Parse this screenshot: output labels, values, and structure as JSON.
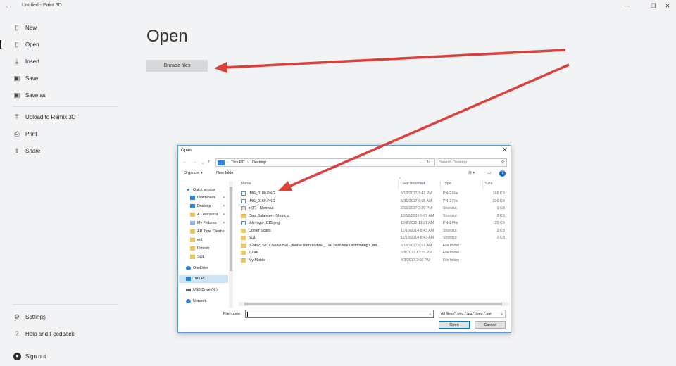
{
  "window": {
    "title": "Untitled - Paint 3D",
    "minimize_glyph": "—",
    "restore_glyph": "❐",
    "close_glyph": "✕"
  },
  "menu": {
    "items": [
      {
        "label": "New",
        "icon": "new-file-icon"
      },
      {
        "label": "Open",
        "icon": "folder-open-icon",
        "active": true
      },
      {
        "label": "Insert",
        "icon": "insert-icon"
      },
      {
        "label": "Save",
        "icon": "save-icon"
      },
      {
        "label": "Save as",
        "icon": "save-as-icon"
      },
      {
        "label": "Upload to Remix 3D",
        "icon": "upload-icon"
      },
      {
        "label": "Print",
        "icon": "print-icon"
      },
      {
        "label": "Share",
        "icon": "share-icon"
      }
    ],
    "bottom": [
      {
        "label": "Settings",
        "icon": "gear-icon"
      },
      {
        "label": "Help and Feedback",
        "icon": "help-icon"
      },
      {
        "label": "Sign out",
        "icon": "user-icon"
      }
    ]
  },
  "main": {
    "heading": "Open",
    "browse_label": "Browse files"
  },
  "dialog": {
    "title": "Open",
    "breadcrumb": [
      "This PC",
      "Desktop"
    ],
    "search_placeholder": "Search Desktop",
    "organize_label": "Organize ▾",
    "new_folder_label": "New folder",
    "nav": [
      {
        "label": "Quick access",
        "icon": "star-icon"
      },
      {
        "label": "Downloads",
        "icon": "download-icon",
        "pinned": true
      },
      {
        "label": "Desktop",
        "icon": "desktop-icon",
        "pinned": true
      },
      {
        "label": "A.Levasseur",
        "icon": "folder-icon",
        "pinned": true
      },
      {
        "label": "My Pictures",
        "icon": "pictures-icon",
        "pinned": true
      },
      {
        "label": "AR Type Clean u",
        "icon": "folder-icon"
      },
      {
        "label": "edi",
        "icon": "folder-icon"
      },
      {
        "label": "Fintech",
        "icon": "folder-icon"
      },
      {
        "label": "SQL",
        "icon": "folder-icon"
      },
      {
        "label": "OneDrive",
        "icon": "cloud-icon"
      },
      {
        "label": "This PC",
        "icon": "computer-icon",
        "selected": true
      },
      {
        "label": "USB Drive (K:)",
        "icon": "usb-drive-icon"
      },
      {
        "label": "Network",
        "icon": "network-icon"
      }
    ],
    "columns": [
      "Name",
      "Date modified",
      "Type",
      "Size"
    ],
    "files": [
      {
        "name": "IMG_0180.PNG",
        "date": "6/13/2017 3:41 PM",
        "type": "PNG File",
        "size": "166 KB",
        "kind": "png"
      },
      {
        "name": "IMG_0169.PNG",
        "date": "5/31/2017 6:55 AM",
        "type": "PNG File",
        "size": "236 KB",
        "kind": "png"
      },
      {
        "name": "z (F) - Shortcut",
        "date": "2/15/2017 2:20 PM",
        "type": "Shortcut",
        "size": "1 KB",
        "kind": "lnk"
      },
      {
        "name": "Data Balancer - Shortcut",
        "date": "12/12/2016 9:07 AM",
        "type": "Shortcut",
        "size": "2 KB",
        "kind": "lnk"
      },
      {
        "name": "ddc-logo-1015.png",
        "date": "12/8/2015 11:21 AM",
        "type": "PNG File",
        "size": "25 KB",
        "kind": "png"
      },
      {
        "name": "Copier Scans",
        "date": "11/18/2014 8:43 AM",
        "type": "Shortcut",
        "size": "2 KB",
        "kind": "folder"
      },
      {
        "name": "SQL",
        "date": "11/18/2014 8:43 AM",
        "type": "Shortcut",
        "size": "2 KB",
        "kind": "folder"
      },
      {
        "name": "[#2452] So. Colonie Bid - please burn to disk _ DeCrescente Distributing Com...",
        "date": "6/15/2017 9:51 AM",
        "type": "File folder",
        "size": "",
        "kind": "folder"
      },
      {
        "name": "JUNK",
        "date": "6/8/2017 12:55 PM",
        "type": "File folder",
        "size": "",
        "kind": "folder"
      },
      {
        "name": "My Mobile",
        "date": "4/3/2017 2:06 PM",
        "type": "File folder",
        "size": "",
        "kind": "folder"
      }
    ],
    "filename_label": "File name:",
    "filename_value": "",
    "filter_label": "All files (*.png;*.jpg;*.jpeg;*.jpe",
    "open_label": "Open",
    "cancel_label": "Cancel"
  },
  "colors": {
    "arrow": "#d9413a",
    "accent": "#0078d7"
  }
}
